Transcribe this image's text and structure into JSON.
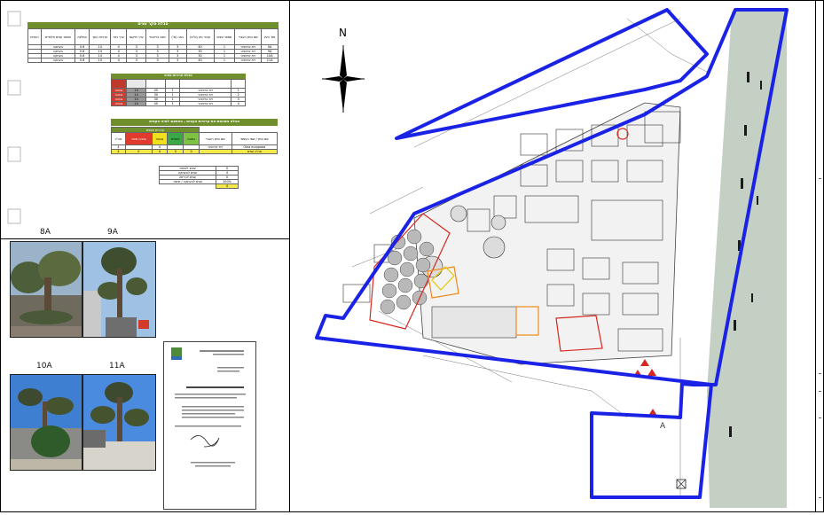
{
  "tables": {
    "tree_survey": {
      "title": "טבלת סקר עצים",
      "headers": [
        "מס' העץ",
        "שם המין העברי",
        "מספר עצים",
        "קוטר גזע (ס\"מ)",
        "גובה (מ')",
        "מצב בריאותי",
        "ערך מיקום",
        "ערך נופי",
        "ערכיות העץ",
        "המלצה",
        "מספר עצים חלופיים",
        "הערות"
      ],
      "rows": [
        [
          "0A",
          "זית אירופאי",
          "1",
          "40",
          "3",
          "3",
          "3",
          "4",
          "14",
          "0.6",
          "העתקה"
        ],
        [
          "9A",
          "זית אירופאי",
          "1",
          "30",
          "3",
          "3",
          "3",
          "4",
          "14",
          "0.6",
          "העתקה"
        ],
        [
          "10A",
          "זית אירופאי",
          "1",
          "30",
          "3",
          "3",
          "3",
          "4",
          "14",
          "0.6",
          "העתקה"
        ],
        [
          "11A",
          "זית אירופאי",
          "1",
          "40",
          "3",
          "3",
          "3",
          "4",
          "14",
          "0.6",
          "העתקה"
        ]
      ]
    },
    "tree_values": {
      "title": "טבלת ערכיות עצים",
      "rows": [
        [
          "1",
          "זית אירופאי",
          "1",
          "40",
          "14",
          "גבוהה"
        ],
        [
          "2",
          "זית אירופאי",
          "1",
          "30",
          "14",
          "גבוהה"
        ],
        [
          "3",
          "זית אירופאי",
          "1",
          "30",
          "14",
          "גבוהה"
        ],
        [
          "4",
          "זית אירופאי",
          "1",
          "40",
          "14",
          "גבוהה"
        ]
      ]
    },
    "summary": {
      "title": "טבלה מסכמת את ערכיות העצים , בהתאם למיני העצים",
      "group_header": "ערכיות העצים",
      "headers": [
        "שם המין / שמו העממי",
        "שם המין העברי",
        "נמוכה",
        "בינונית",
        "גבוהה",
        "גבוהה מאוד",
        "סה\"כ"
      ],
      "row": [
        "Olea europaea",
        "זית אירופאי",
        "",
        "",
        "4",
        "",
        "4"
      ],
      "total_row": [
        "סה\"כ עצים",
        "",
        "0",
        "0",
        "4",
        "0",
        "4"
      ]
    },
    "totals": {
      "rows": [
        [
          "0",
          "עצים לשימור"
        ],
        [
          "4",
          "עצים להעתקה"
        ],
        [
          "0",
          "עצים לכריתה"
        ],
        [
          "100%",
          "עצים להעתקה / שימור"
        ],
        [
          "4",
          "סה\"כ"
        ]
      ]
    }
  },
  "photos": [
    {
      "label": "8A"
    },
    {
      "label": "9A"
    },
    {
      "label": "10A"
    },
    {
      "label": "11A"
    }
  ],
  "map": {
    "north_label": "N",
    "building_label": "A"
  }
}
